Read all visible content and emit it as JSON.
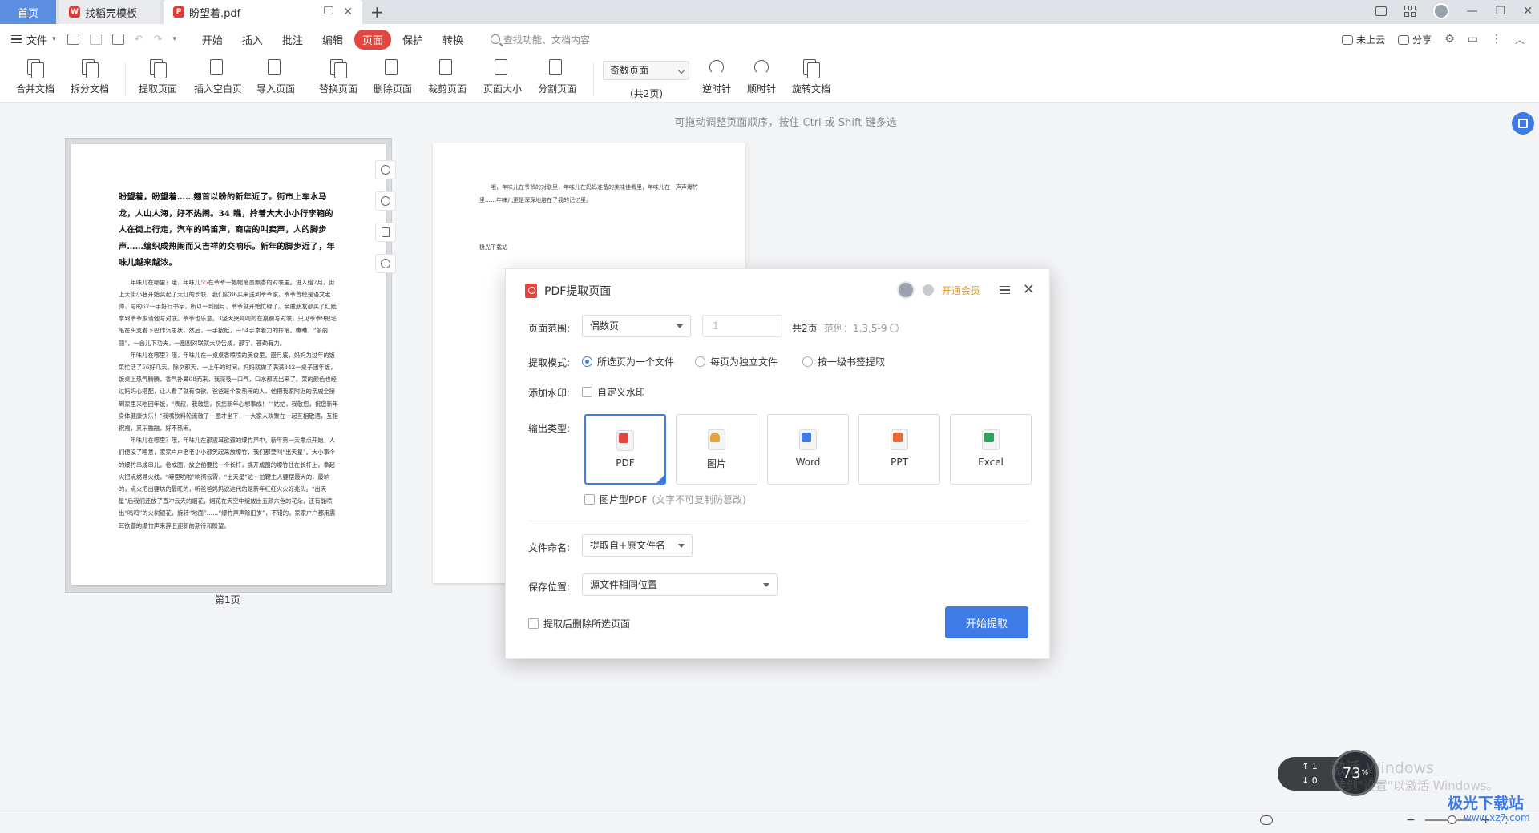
{
  "tabs": {
    "home": "首页",
    "tab1": "找稻壳模板",
    "tab2": "盼望着.pdf"
  },
  "menu": {
    "file": "文件",
    "tabs": [
      "开始",
      "插入",
      "批注",
      "编辑",
      "页面",
      "保护",
      "转换"
    ],
    "active_tab": "页面",
    "search_placeholder": "查找功能、文档内容",
    "cloud": "未上云",
    "share": "分享"
  },
  "ribbon": {
    "merge": "合并文档",
    "split": "拆分文档",
    "extract": "提取页面",
    "insert_blank": "插入空白页",
    "import": "导入页面",
    "replace": "替换页面",
    "delete": "删除页面",
    "crop": "裁剪页面",
    "size": "页面大小",
    "divide": "分割页面",
    "page_filter": "奇数页面",
    "page_total": "(共2页)",
    "ccw": "逆时针",
    "cw": "顺时针",
    "rotate": "旋转文档"
  },
  "workspace": {
    "hint": "可拖动调整页面顺序，按住 Ctrl 或 Shift 键多选",
    "page1_label": "第1页"
  },
  "page1": {
    "heading": "盼望着，盼望着……翘首以盼的新年近了。街市上车水马龙，人山人海，好不热闹。34 瞧，拎着大大小小行李箱的人在街上行走，汽车的鸣笛声，商店的叫卖声，人的脚步声……编织成热闹而又吉祥的交响乐。新年的脚步近了，年味儿越来越浓。",
    "para1_a": "年味儿在哪里？哦，年味儿",
    "para1_red": "55",
    "para1_b": "在爷爷一幅幅笔墨飘香的对联里。进入腊2月，街上大街小巷开始买起了大红的长联，我们就86买来送到爷爷家。爷爷曾经是语文老师，写的67一手好行书字，所以一到腊月，爷爷就开始忙碌了。亲戚朋友都买了红纸拿到爷爷家请他写对联。爷爷也乐意。3坚天哭呵呵的在桌前写对联，只见爷爷9把毛笔在头支着下巴作沉思状，然后，一手按纸，一54手拿着力的挥笔。瞧瞧，“丽丽丽”，一会儿下功夫，一副副对联就大功告成，那字，苍劲有力。",
    "para2": "年味儿在哪里？哦，年味儿在一桌桌香喷喷的美食里。腊月底，妈妈为过年的饭菜忙活了56好几天。除夕那天，一上午的时间，妈妈就做了满满342一桌子团年饭，饭桌上热气腾腾，香气扑鼻08而来，我深吸一口气，口水都流出来了。菜的颜色也经过妈妈心搭配，让人看了就有食欲。爸爸是个爱热闹的人，他把我家附近的亲戚全接到家里来吃团年饭，“表叔，我敬您，祝您新年心想事成！”“姑姑，我敬您，祝您新年身体健康快乐！”我嘴饮料轮流敬了一圈才坐下，一大家人欢聚在一起互相敬酒，互相祝福，其乐融融，好不热闹。",
    "para3": "年味儿在哪里？哦，年味儿在那震耳欲聋的爆竹声中。新年第一天零点开始，人们便没了睡意，家家户户老老小小都笑起来放爆竹，我们都要叫“出天星”。大小事个的爆竹串成串儿，卷成圈，放之前要找一个长杆，挑开成圈的爆竹往在长杆上，拿起火把点燃导火线，“噼里啪啦”响彻云霄，“出天星”这一拍鞭主人要摆最大的，最响的，点火把出要坊的最旺的，听爸爸妈妈说这代的是新年红红火火好兆头。“出天星”后我们还放了直冲云天的烟花，烟花在天空中绽放出五颜六色的花朵，还有能喷出“鸣鸣”的火树银花，旋转“地面”……“爆竹声声除旧岁”，不错的，家家户户都用震耳欲聋的爆竹声来辞旧迎新的期待和盼望。"
  },
  "page2": {
    "para": "哦，年味儿在爷爷的对联里，年味儿在妈妈准备的美味佳肴里，年味儿在一声声爆竹里……年味儿更是深深地烙在了我的记忆里。",
    "sign": "极光下载站"
  },
  "dialog": {
    "title": "PDF提取页面",
    "vip": "开通会员",
    "page_range_label": "页面范围:",
    "page_range_value": "偶数页",
    "page_input_placeholder": "1",
    "total_pages": "共2页",
    "example": "范例：1,3,5-9",
    "mode_label": "提取模式:",
    "mode_options": [
      "所选页为一个文件",
      "每页为独立文件",
      "按一级书签提取"
    ],
    "watermark_label": "添加水印:",
    "watermark_custom": "自定义水印",
    "output_label": "输出类型:",
    "formats": [
      "PDF",
      "图片",
      "Word",
      "PPT",
      "Excel"
    ],
    "image_pdf": "图片型PDF",
    "image_pdf_note": "(文字不可复制防篡改)",
    "naming_label": "文件命名:",
    "naming_value": "提取自+原文件名",
    "save_label": "保存位置:",
    "save_value": "源文件相同位置",
    "delete_after": "提取后删除所选页面",
    "start": "开始提取"
  },
  "overlay": {
    "net_up": "1",
    "net_down": "0",
    "gauge": "73",
    "gauge_unit": "%",
    "activate": "激活 Windows",
    "activate_sub": "转到\"设置\"以激活 Windows。",
    "site_logo": "极光下载站",
    "site_url": "www.xz7.com"
  },
  "colors": {
    "accent": "#3e7be6",
    "active_tab": "#e2463f",
    "vip": "#e89a1e"
  }
}
